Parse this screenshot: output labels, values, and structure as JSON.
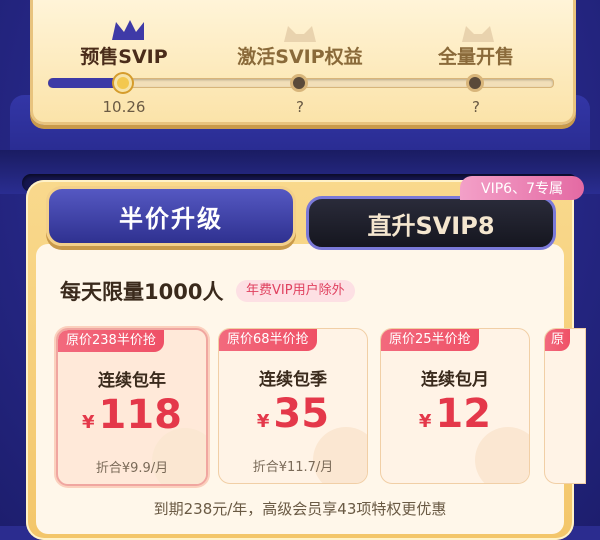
{
  "progress": {
    "stages": [
      {
        "label": "预售SVIP",
        "value": "10.26",
        "active": true
      },
      {
        "label": "激活SVIP权益",
        "value": "?",
        "active": false
      },
      {
        "label": "全量开售",
        "value": "?",
        "active": false
      }
    ],
    "fraction_complete": 0.15
  },
  "tabs": {
    "left_label": "半价升级",
    "right_label": "直升SVIP8",
    "right_tag": "VIP6、7专属"
  },
  "headline": "每天限量1000人",
  "badge": "年费VIP用户除外",
  "plans": [
    {
      "tag": "原价238半价抢",
      "name": "连续包年",
      "currency": "¥",
      "price": "118",
      "sub": "折合¥9.9/月",
      "selected": true
    },
    {
      "tag": "原价68半价抢",
      "name": "连续包季",
      "currency": "¥",
      "price": "35",
      "sub": "折合¥11.7/月",
      "selected": false
    },
    {
      "tag": "原价25半价抢",
      "name": "连续包月",
      "currency": "¥",
      "price": "12",
      "sub": "",
      "selected": false
    }
  ],
  "peek_tag": "原",
  "footnote": "到期238元/年，高级会员享43项特权更优惠",
  "colors": {
    "brand_blue": "#2b2c8f",
    "gold": "#f3c66a",
    "price_red": "#e4384a",
    "tag_red": "#ef5066"
  }
}
